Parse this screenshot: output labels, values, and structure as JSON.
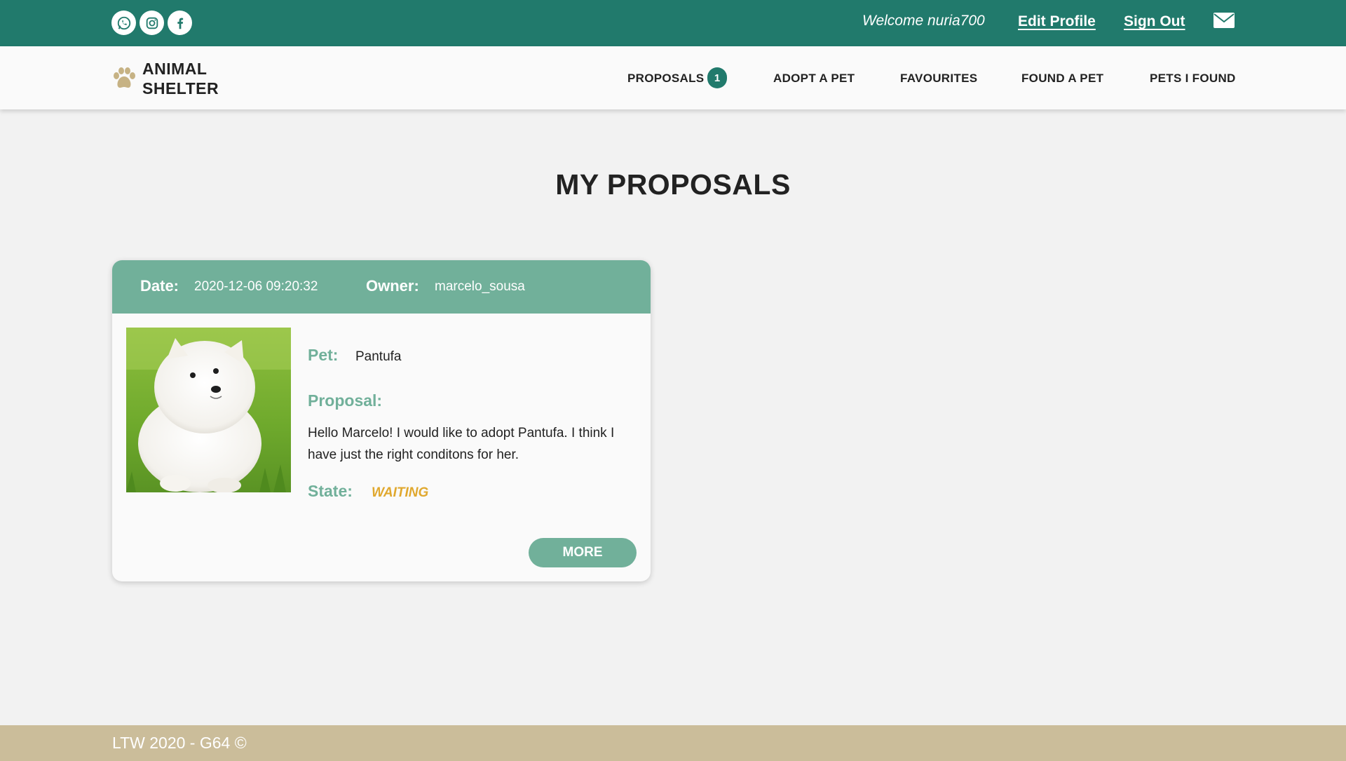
{
  "topbar": {
    "socials": [
      {
        "icon": "whatsapp-icon"
      },
      {
        "icon": "instagram-icon"
      },
      {
        "icon": "facebook-icon"
      }
    ],
    "welcome": "Welcome nuria700",
    "edit_profile": "Edit Profile",
    "sign_out": "Sign Out",
    "mail_icon": "envelope-icon",
    "color": "#217a6c"
  },
  "navbar": {
    "brand_line1": "ANIMAL",
    "brand_line2": "SHELTER",
    "brand_icon": "paw-icon",
    "items": [
      {
        "label": "PROPOSALS",
        "badge": "1"
      },
      {
        "label": "ADOPT A PET"
      },
      {
        "label": "FAVOURITES"
      },
      {
        "label": "FOUND A PET"
      },
      {
        "label": "PETS I FOUND"
      }
    ]
  },
  "main": {
    "title": "MY PROPOSALS",
    "proposals": [
      {
        "date_label": "Date:",
        "date": "2020-12-06 09:20:32",
        "owner_label": "Owner:",
        "owner": "marcelo_sousa",
        "pet_label": "Pet:",
        "pet": "Pantufa",
        "proposal_label": "Proposal:",
        "proposal_text": "Hello Marcelo! I would like to adopt Pantufa. I think I have just the right conditons for her.",
        "state_label": "State:",
        "state": "WAITING",
        "more_label": "MORE"
      }
    ]
  },
  "footer": {
    "text": "LTW 2020 - G64 ©"
  },
  "colors": {
    "primary": "#217a6c",
    "accent": "#71b09a",
    "state_waiting": "#e0a82e",
    "footer": "#cbbd9a"
  }
}
